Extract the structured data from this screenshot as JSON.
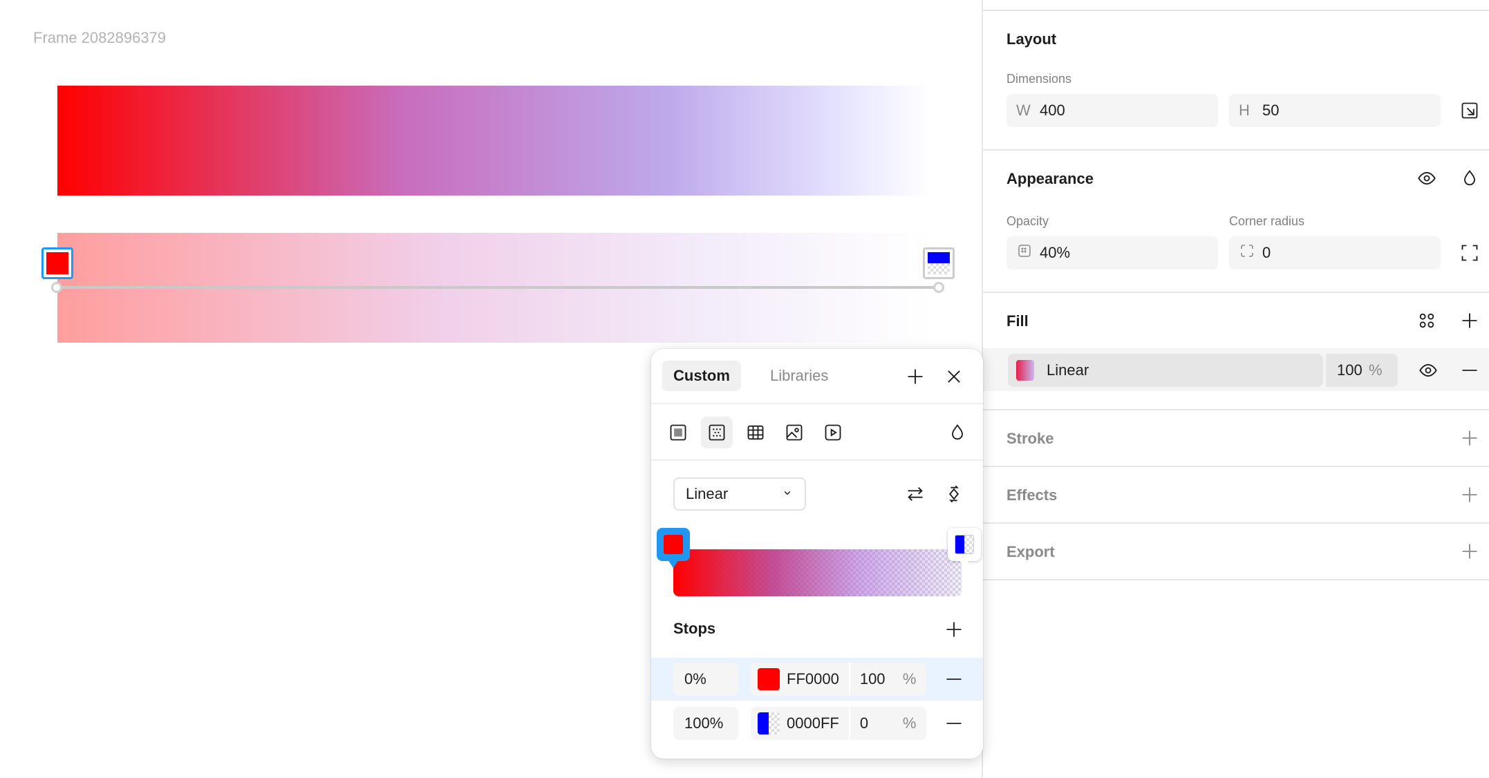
{
  "canvas": {
    "frame_label": "Frame 2082896379",
    "gradient_start_color": "#ff0000",
    "gradient_end_color": "#0000ff"
  },
  "panel": {
    "layout": {
      "title": "Layout",
      "dimensions_label": "Dimensions",
      "width_prefix": "W",
      "width_value": "400",
      "height_prefix": "H",
      "height_value": "50"
    },
    "appearance": {
      "title": "Appearance",
      "opacity_label": "Opacity",
      "opacity_value": "40%",
      "corner_radius_label": "Corner radius",
      "corner_radius_value": "0"
    },
    "fill": {
      "title": "Fill",
      "type_label": "Linear",
      "opacity_value": "100",
      "opacity_unit": "%"
    },
    "stroke": {
      "title": "Stroke"
    },
    "effects": {
      "title": "Effects"
    },
    "export": {
      "title": "Export"
    }
  },
  "popup": {
    "tabs": [
      {
        "label": "Custom",
        "active": true
      },
      {
        "label": "Libraries",
        "active": false
      }
    ],
    "gradient_type": "Linear",
    "stops_title": "Stops",
    "stops": [
      {
        "position": "0%",
        "hex": "FF0000",
        "opacity": "100",
        "unit": "%",
        "color": "#ff0000",
        "selected": true
      },
      {
        "position": "100%",
        "hex": "0000FF",
        "opacity": "0",
        "unit": "%",
        "color": "#0000ff",
        "selected": false
      }
    ]
  }
}
